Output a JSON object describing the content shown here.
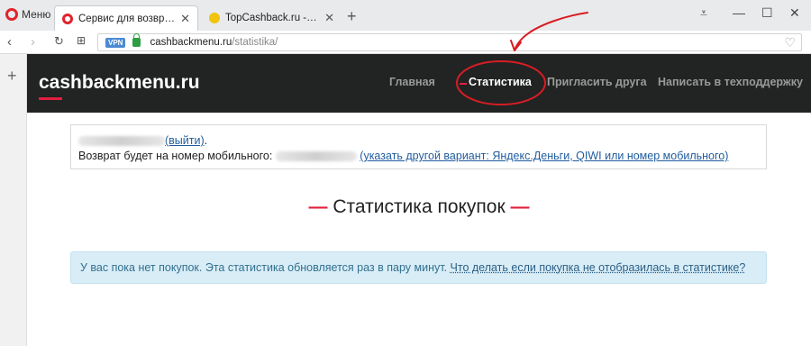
{
  "browser": {
    "menu_label": "Меню",
    "tabs": [
      {
        "label": "Сервис для возврата кэш",
        "active": true
      },
      {
        "label": "TopCashback.ru - Топ лучш",
        "active": false
      }
    ],
    "url_host": "cashbackmenu.ru",
    "url_path": "/statistika/",
    "vpn_label": "VPN"
  },
  "site": {
    "brand": "cashbackmenu.ru",
    "nav": [
      {
        "label": "Главная",
        "active": false
      },
      {
        "label": "Статистика",
        "active": true
      },
      {
        "label": "Пригласить друга",
        "active": false
      },
      {
        "label": "Написать в техподдержку",
        "active": false
      }
    ],
    "user_box": {
      "logout_link": "(выйти)",
      "logout_suffix": ".",
      "refund_text": "Возврат будет на номер мобильного:",
      "change_link": "(указать другой вариант: Яндекс.Деньги, QIWI или номер мобильного)"
    },
    "stats_title": "Статистика покупок",
    "title_dash": "—",
    "alert": {
      "text": "У вас пока нет покупок. Эта статистика обновляется раз в пару минут.",
      "link": "Что делать если покупка не отобразилась в статистике?"
    }
  },
  "colors": {
    "accent_red": "#e21f3d",
    "header_bg": "#222323",
    "alert_bg": "#d9edf7",
    "link_blue": "#1f5c9e"
  }
}
